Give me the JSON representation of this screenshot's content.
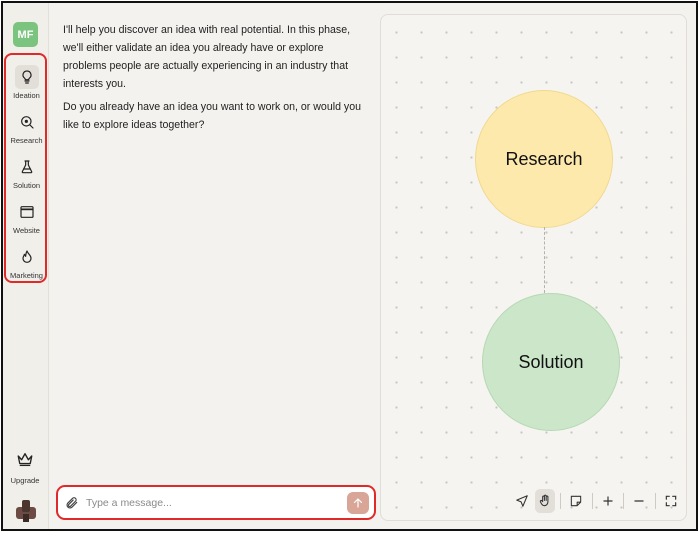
{
  "user": {
    "initials": "MF"
  },
  "sidebar": {
    "items": [
      {
        "label": "Ideation",
        "icon": "lightbulb-icon",
        "active": true
      },
      {
        "label": "Research",
        "icon": "magnifier-icon",
        "active": false
      },
      {
        "label": "Solution",
        "icon": "flask-icon",
        "active": false
      },
      {
        "label": "Website",
        "icon": "browser-window-icon",
        "active": false
      },
      {
        "label": "Marketing",
        "icon": "flame-icon",
        "active": false
      }
    ],
    "upgrade_label": "Upgrade"
  },
  "chat": {
    "messages": [
      "I'll help you discover an idea with real potential. In this phase, we'll either validate an idea you already have or explore problems people are actually experiencing in an industry that interests you.",
      "Do you already have an idea you want to work on, or would you like to explore ideas together?"
    ],
    "composer": {
      "placeholder": "Type a message..."
    }
  },
  "canvas": {
    "nodes": [
      {
        "label": "Research",
        "color": "#fde9ac"
      },
      {
        "label": "Solution",
        "color": "#cbe6c8"
      }
    ],
    "toolbar": [
      "navigate-icon",
      "hand-icon",
      "sticky-note-icon",
      "zoom-in-icon",
      "zoom-out-icon",
      "fullscreen-icon"
    ]
  },
  "colors": {
    "accent": "#e02a2a",
    "send": "#d8a597",
    "avatar": "#7bc47f"
  }
}
